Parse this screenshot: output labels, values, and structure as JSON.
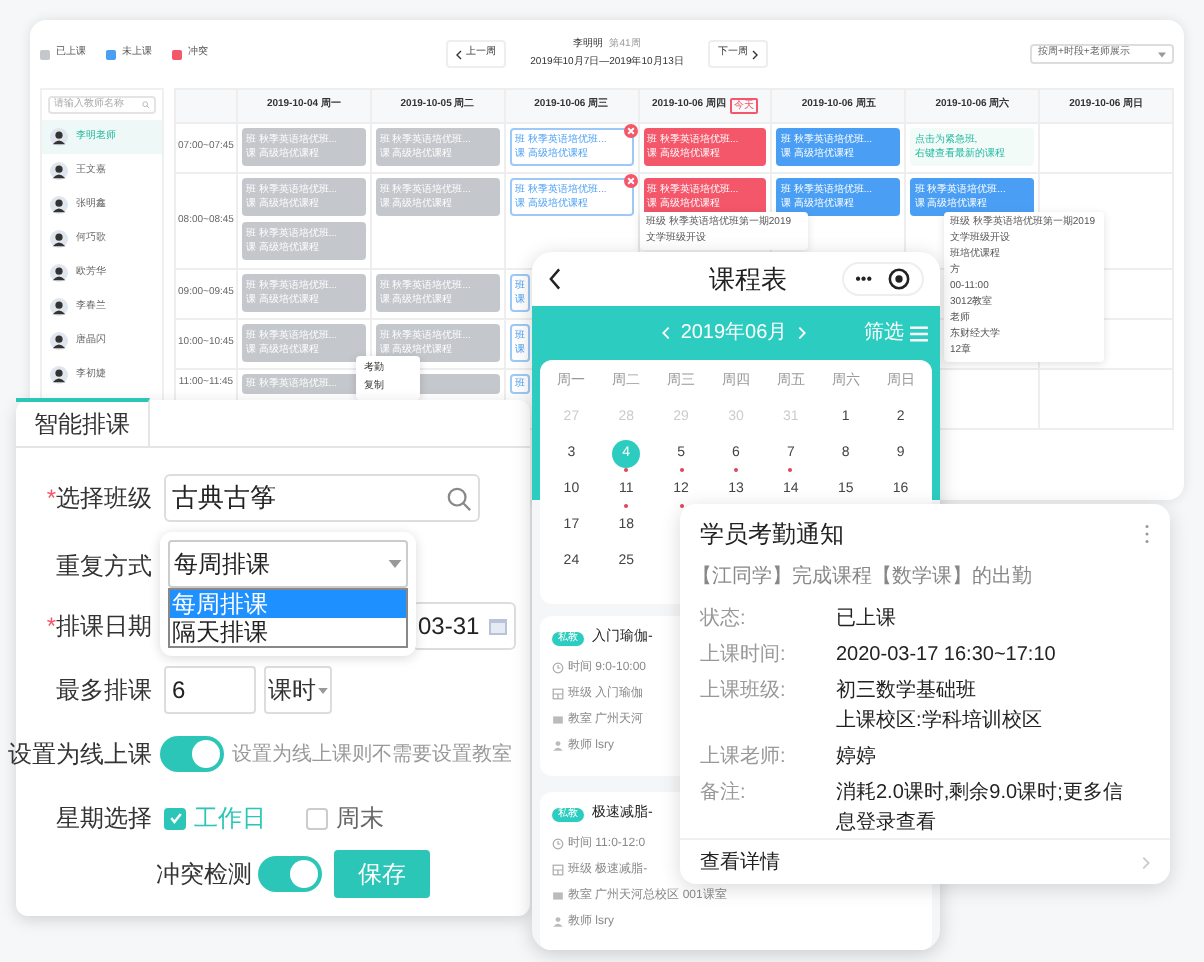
{
  "legend": [
    {
      "label": "已上课",
      "color": "#c4c7cc"
    },
    {
      "label": "未上课",
      "color": "#4a9ff5"
    },
    {
      "label": "冲突",
      "color": "#f4566a"
    }
  ],
  "nav": {
    "prev": "上一周",
    "teacher": "李明明",
    "week": "第41周",
    "range": "2019年10月7日—2019年10月13日",
    "next": "下一周",
    "view": "按周+时段+老师展示"
  },
  "sidebar": {
    "placeholder": "请输入教师名称",
    "teachers": [
      {
        "name": "李明老师",
        "selected": true
      },
      {
        "name": "王文嘉",
        "selected": false
      },
      {
        "name": "张明鑫",
        "selected": false
      },
      {
        "name": "何巧歌",
        "selected": false
      },
      {
        "name": "欧芳华",
        "selected": false
      },
      {
        "name": "李春兰",
        "selected": false
      },
      {
        "name": "唐晶闪",
        "selected": false
      },
      {
        "name": "李初婕",
        "selected": false
      }
    ]
  },
  "grid": {
    "columns": [
      {
        "label": "2019-10-04 周一"
      },
      {
        "label": "2019-10-05 周二"
      },
      {
        "label": "2019-10-06 周三"
      },
      {
        "label": "2019-10-06 周四",
        "badge": "今天"
      },
      {
        "label": "2019-10-06 周五"
      },
      {
        "label": "2019-10-06 周六"
      },
      {
        "label": "2019-10-06 周日"
      }
    ],
    "rows": [
      {
        "time": "07:00~07:45",
        "cells": [
          [
            {
              "kind": "done",
              "lines": [
                {
                  "tag": "班",
                  "text": "秋季英语培优班..."
                },
                {
                  "tag": "课",
                  "text": "高级培优课程"
                }
              ]
            }
          ],
          [
            {
              "kind": "done",
              "lines": [
                {
                  "tag": "班",
                  "text": "秋季英语培优班..."
                },
                {
                  "tag": "课",
                  "text": "高级培优课程"
                }
              ]
            }
          ],
          [
            {
              "kind": "outline",
              "flag": true,
              "lines": [
                {
                  "tag": "班",
                  "text": "秋季英语培优班..."
                },
                {
                  "tag": "课",
                  "text": "高级培优课程"
                }
              ]
            }
          ],
          [
            {
              "kind": "conflict",
              "lines": [
                {
                  "tag": "班",
                  "text": "秋季英语培优班..."
                },
                {
                  "tag": "课",
                  "text": "高级培优课程"
                }
              ]
            }
          ],
          [
            {
              "kind": "pending",
              "lines": [
                {
                  "tag": "班",
                  "text": "秋季英语培优班..."
                },
                {
                  "tag": "课",
                  "text": "高级培优课程"
                }
              ]
            }
          ],
          [
            {
              "kind": "note",
              "lines": [
                {
                  "text": "点击为紧急班,"
                },
                {
                  "text": "右键查看最新的课程"
                }
              ]
            }
          ],
          []
        ]
      },
      {
        "time": "08:00~08:45",
        "cells": [
          [
            {
              "kind": "done",
              "lines": [
                {
                  "tag": "班",
                  "text": "秋季英语培优班..."
                },
                {
                  "tag": "课",
                  "text": "高级培优课程"
                }
              ]
            },
            {
              "kind": "done",
              "lines": [
                {
                  "tag": "班",
                  "text": "秋季英语培优班..."
                },
                {
                  "tag": "课",
                  "text": "高级培优课程"
                }
              ]
            }
          ],
          [
            {
              "kind": "done",
              "lines": [
                {
                  "tag": "班",
                  "text": "秋季英语培优班..."
                },
                {
                  "tag": "课",
                  "text": "高级培优课程"
                }
              ]
            }
          ],
          [
            {
              "kind": "outline",
              "flag": true,
              "lines": [
                {
                  "tag": "班",
                  "text": "秋季英语培优班..."
                },
                {
                  "tag": "课",
                  "text": "高级培优课程"
                }
              ]
            }
          ],
          [
            {
              "kind": "conflict",
              "lines": [
                {
                  "tag": "班",
                  "text": "秋季英语培优班..."
                },
                {
                  "tag": "课",
                  "text": "高级培优课程"
                }
              ]
            }
          ],
          [
            {
              "kind": "pending",
              "lines": [
                {
                  "tag": "班",
                  "text": "秋季英语培优班..."
                },
                {
                  "tag": "课",
                  "text": "高级培优课程"
                }
              ]
            }
          ],
          [
            {
              "kind": "pending",
              "lines": [
                {
                  "tag": "班",
                  "text": "秋季英语培优班..."
                },
                {
                  "tag": "课",
                  "text": "高级培优课程"
                }
              ]
            }
          ],
          []
        ]
      },
      {
        "time": "09:00~09:45",
        "cells": [
          [
            {
              "kind": "done",
              "lines": [
                {
                  "tag": "班",
                  "text": "秋季英语培优班..."
                },
                {
                  "tag": "课",
                  "text": "高级培优课程"
                }
              ]
            }
          ],
          [
            {
              "kind": "done",
              "lines": [
                {
                  "tag": "班",
                  "text": "秋季英语培优班..."
                },
                {
                  "tag": "课",
                  "text": "高级培优课程"
                }
              ]
            }
          ],
          [
            {
              "kind": "outline",
              "lines": [
                {
                  "tag": "班"
                },
                {
                  "tag": "课"
                }
              ]
            }
          ],
          [],
          [],
          [],
          []
        ]
      },
      {
        "time": "10:00~10:45",
        "cells": [
          [
            {
              "kind": "done",
              "lines": [
                {
                  "tag": "班",
                  "text": "秋季英语培优班..."
                },
                {
                  "tag": "课",
                  "text": "高级培优课程"
                }
              ]
            }
          ],
          [
            {
              "kind": "done",
              "lines": [
                {
                  "tag": "班",
                  "text": "秋季英语培优班..."
                },
                {
                  "tag": "课",
                  "text": "高级培优课程"
                }
              ]
            }
          ],
          [
            {
              "kind": "outline",
              "lines": [
                {
                  "tag": "班"
                },
                {
                  "tag": "课"
                }
              ]
            }
          ],
          [],
          [],
          [],
          []
        ]
      },
      {
        "time": "11:00~11:45",
        "cells": [
          [
            {
              "kind": "done",
              "lines": [
                {
                  "tag": "班",
                  "text": "秋季英语培优班..."
                }
              ]
            }
          ],
          [
            {
              "kind": "done"
            }
          ],
          [
            {
              "kind": "outline",
              "lines": [
                {
                  "tag": "班"
                }
              ]
            }
          ],
          [],
          [],
          [],
          []
        ]
      }
    ],
    "hover_cards": [
      {
        "lines": [
          "班级 秋季英语培优班第一期2019",
          "文学班级开设"
        ]
      },
      {
        "lines": [
          "班级 秋季英语培优班第一期2019",
          "文学班级开设",
          "班培优课程",
          "方",
          "00-11:00",
          "3012教室",
          "老师",
          "东财经大学",
          "12章"
        ]
      }
    ],
    "context_menu": [
      "考勤",
      "复制"
    ]
  },
  "form": {
    "tab": "智能排课",
    "class": {
      "label": "选择班级",
      "asterisk": "*",
      "value": "古典古筝"
    },
    "repeat": {
      "label": "重复方式",
      "value": "每周排课",
      "options": [
        {
          "label": "每周排课",
          "selected": true
        },
        {
          "label": "隔天排课",
          "selected": false
        }
      ]
    },
    "date": {
      "label": "排课日期",
      "asterisk": "*",
      "value": "03-31"
    },
    "max": {
      "label": "最多排课",
      "value": "6",
      "unit": "课时"
    },
    "online": {
      "label": "设置为线上课",
      "on": true,
      "hint": "设置为线上课则不需要设置教室"
    },
    "weekdays": {
      "label": "星期选择",
      "options": [
        {
          "label": "工作日",
          "checked": true
        },
        {
          "label": "周末",
          "checked": false
        }
      ]
    },
    "conflict": {
      "label": "冲突检测",
      "on": true
    },
    "save": "保存"
  },
  "phone": {
    "title": "课程表",
    "menu": "•••",
    "month": "2019年06月",
    "filter": "筛选",
    "weekdays": [
      "周一",
      "周二",
      "周三",
      "周四",
      "周五",
      "周六",
      "周日"
    ],
    "weeks": [
      [
        {
          "day": "27",
          "muted": true
        },
        {
          "day": "28",
          "muted": true
        },
        {
          "day": "29",
          "muted": true
        },
        {
          "day": "30",
          "muted": true
        },
        {
          "day": "31",
          "muted": true
        },
        {
          "day": "1",
          "muted": false
        },
        {
          "day": "2",
          "muted": false
        }
      ],
      [
        {
          "day": "3"
        },
        {
          "day": "4",
          "selected": true,
          "dot": true
        },
        {
          "day": "5",
          "dot": true
        },
        {
          "day": "6",
          "dot": true
        },
        {
          "day": "7",
          "dot": true
        },
        {
          "day": "8"
        },
        {
          "day": "9"
        }
      ],
      [
        {
          "day": "10"
        },
        {
          "day": "11",
          "dot": true
        },
        {
          "day": "12",
          "dot": true
        },
        {
          "day": "13"
        },
        {
          "day": "14"
        },
        {
          "day": "15"
        },
        {
          "day": "16"
        }
      ],
      [
        {
          "day": "17"
        },
        {
          "day": "18"
        }
      ],
      [
        {
          "day": "24"
        },
        {
          "day": "25"
        }
      ]
    ],
    "courses": [
      {
        "badge": "私教",
        "name": "入门瑜伽-",
        "time": "时间 9:0-10:00",
        "class": "班级 入门瑜伽",
        "room": "教室 广州天河",
        "teacher": "教师 lsry"
      },
      {
        "badge": "私教",
        "name": "极速减脂-",
        "time": "时间 11:0-12:0",
        "class": "班级 极速减脂-",
        "room": "教室 广州天河总校区  001课室",
        "teacher": "教师 lsry"
      }
    ]
  },
  "notice": {
    "title": "学员考勤通知",
    "subtitle": "【江同学】完成课程【数学课】的出勤",
    "fields": [
      {
        "label": "状态:",
        "values": [
          "已上课"
        ]
      },
      {
        "label": "上课时间:",
        "values": [
          "2020-03-17 16:30~17:10"
        ]
      },
      {
        "label": "上课班级:",
        "values": [
          "初三数学基础班",
          "上课校区:学科培训校区"
        ]
      },
      {
        "label": "上课老师:",
        "values": [
          "婷婷"
        ]
      },
      {
        "label": "备注:",
        "values": [
          "消耗2.0课时,剩余9.0课时;更多信息登录查看"
        ]
      }
    ],
    "link": "查看详情"
  }
}
